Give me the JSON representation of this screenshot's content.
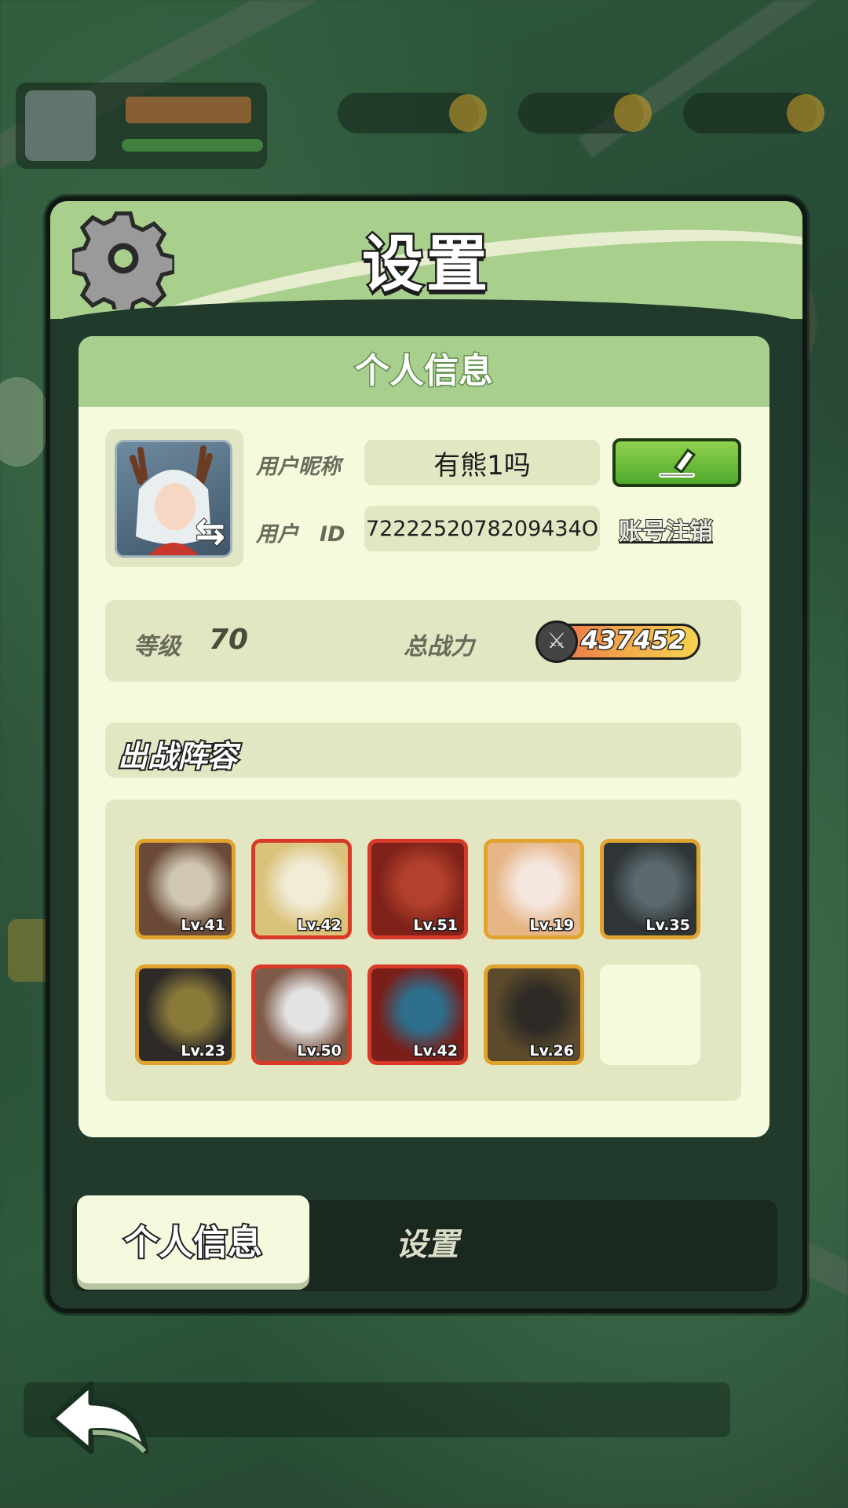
{
  "modal": {
    "title": "设置",
    "section_title": "个人信息"
  },
  "profile": {
    "nickname_label": "用户昵称",
    "nickname_value": "有熊1吗",
    "id_label": "用户　ID",
    "id_value": "7222252078209434O",
    "cancel_account_label": "账号注销"
  },
  "stats": {
    "level_label": "等级",
    "level_value": "70",
    "power_label": "总战力",
    "power_value": "437452"
  },
  "lineup": {
    "title": "出战阵容",
    "heroes": [
      {
        "level": "Lv.41",
        "rarity": "gold"
      },
      {
        "level": "Lv.42",
        "rarity": "red"
      },
      {
        "level": "Lv.51",
        "rarity": "red"
      },
      {
        "level": "Lv.19",
        "rarity": "gold"
      },
      {
        "level": "Lv.35",
        "rarity": "gold"
      },
      {
        "level": "Lv.23",
        "rarity": "gold"
      },
      {
        "level": "Lv.50",
        "rarity": "red"
      },
      {
        "level": "Lv.42",
        "rarity": "red"
      },
      {
        "level": "Lv.26",
        "rarity": "gold"
      },
      {
        "level": "",
        "rarity": "empty"
      }
    ]
  },
  "tabs": {
    "active": "个人信息",
    "inactive": "设置"
  },
  "colors": {
    "header_green": "#a8cf8c",
    "panel_cream": "#f6fadc",
    "field_bg": "#e3e6c3",
    "edit_button": "#6cc03a",
    "gold_frame": "#e0a42e",
    "red_frame": "#d93a28"
  }
}
